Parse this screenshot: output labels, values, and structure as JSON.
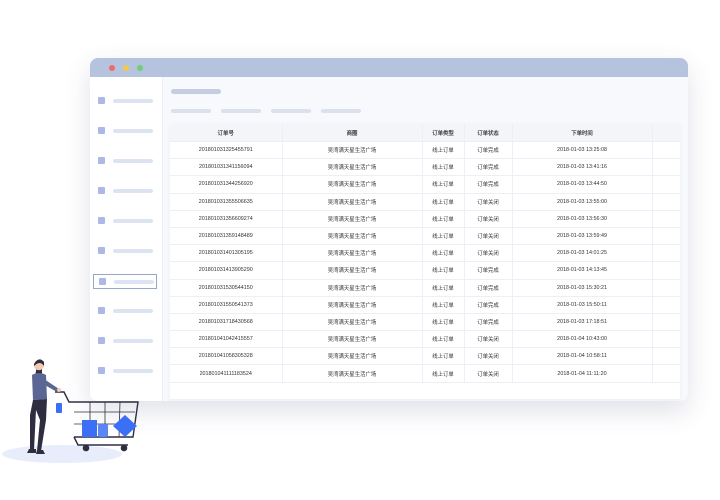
{
  "table": {
    "headers": [
      "订单号",
      "商圈",
      "订单类型",
      "订单状态",
      "下单时间"
    ],
    "rows": [
      [
        "201801031325455791",
        "吴湾满天星生活广场",
        "线上订单",
        "订单完成",
        "2018-01-03 13:25:08"
      ],
      [
        "201801031341156094",
        "吴湾满天星生活广场",
        "线上订单",
        "订单完成",
        "2018-01-03 13:41:16"
      ],
      [
        "201801031344256920",
        "吴湾满天星生活广场",
        "线上订单",
        "订单完成",
        "2018-01-03 13:44:50"
      ],
      [
        "201801031355506635",
        "吴湾满天星生活广场",
        "线上订单",
        "订单关闭",
        "2018-01-03 13:55:00"
      ],
      [
        "201801031356609274",
        "吴湾满天星生活广场",
        "线上订单",
        "订单关闭",
        "2018-01-03 13:56:30"
      ],
      [
        "201801031359148489",
        "吴湾满天星生活广场",
        "线上订单",
        "订单关闭",
        "2018-01-03 13:59:49"
      ],
      [
        "201801031401305195",
        "吴湾满天星生活广场",
        "线上订单",
        "订单关闭",
        "2018-01-03 14:01:25"
      ],
      [
        "201801031413905290",
        "吴湾满天星生活广场",
        "线上订单",
        "订单完成",
        "2018-01-03 14:13:45"
      ],
      [
        "201801031530544150",
        "吴湾满天星生活广场",
        "线上订单",
        "订单完成",
        "2018-01-03 15:30:21"
      ],
      [
        "201801031550541373",
        "吴湾满天星生活广场",
        "线上订单",
        "订单完成",
        "2018-01-03 15:50:11"
      ],
      [
        "201801031718430568",
        "吴湾满天星生活广场",
        "线上订单",
        "订单完成",
        "2018-01-03 17:18:51"
      ],
      [
        "201801041042415557",
        "吴湾满天星生活广场",
        "线上订单",
        "订单关闭",
        "2018-01-04 10:43:00"
      ],
      [
        "201801041058305328",
        "吴湾满天星生活广场",
        "线上订单",
        "订单关闭",
        "2018-01-04 10:58:11"
      ],
      [
        "201801041111183524",
        "吴湾满天星生活广场",
        "线上订单",
        "订单关闭",
        "2018-01-04 11:11:20"
      ]
    ]
  },
  "sidebar": {
    "item_count": 10,
    "active_index": 6
  },
  "colors": {
    "titlebar": "#b6c3de",
    "dot_red": "#ef6a6a",
    "dot_yellow": "#f2c94c",
    "dot_green": "#6fcf72",
    "accent": "#3b6ff5",
    "figure_dark": "#2f2e41"
  }
}
